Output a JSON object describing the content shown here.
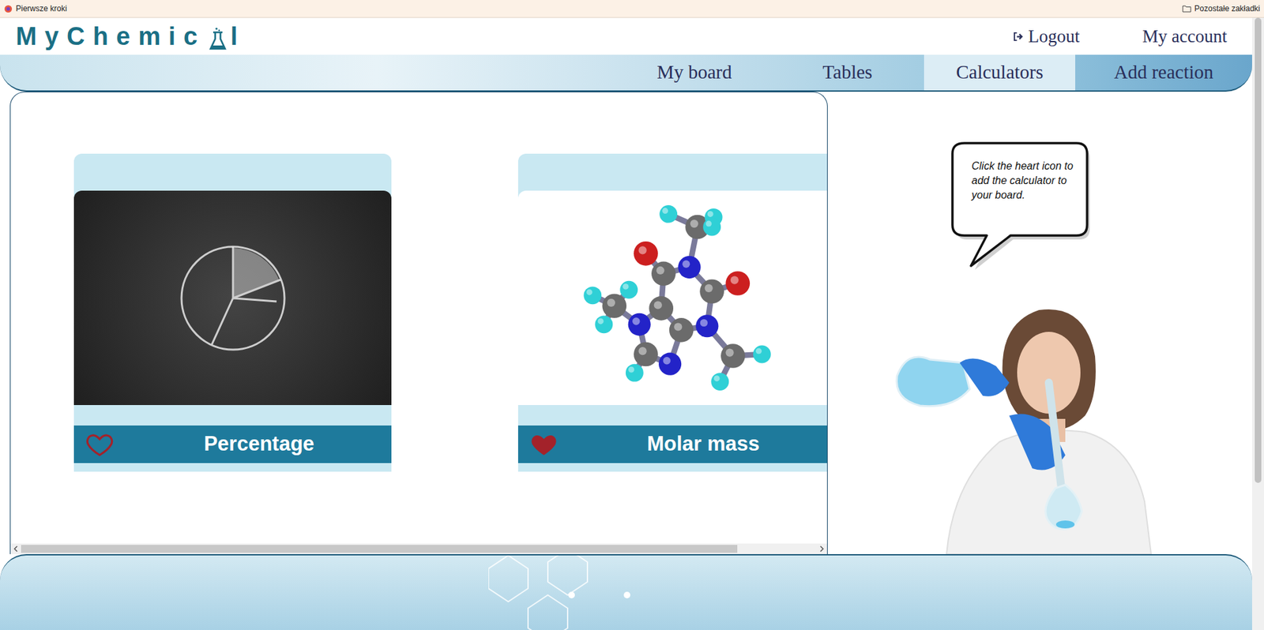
{
  "browser": {
    "bookmarks": [
      {
        "label": "Pierwsze kroki"
      }
    ],
    "other_bookmarks": "Pozostałe zakładki"
  },
  "logo": {
    "before": "MyChemic",
    "after": "l"
  },
  "header_links": [
    {
      "label": "Logout"
    },
    {
      "label": "My account"
    }
  ],
  "nav": [
    {
      "label": "My board",
      "selected": false
    },
    {
      "label": "Tables",
      "selected": false
    },
    {
      "label": "Calculators",
      "selected": true
    },
    {
      "label": "Add reaction",
      "selected": false
    }
  ],
  "calculators": [
    {
      "title": "Percentage",
      "favorite": false
    },
    {
      "title": "Molar mass",
      "favorite": true
    }
  ],
  "hint": "Click the heart icon to add the calculator to your board.",
  "scrollbars": {
    "horizontal": {
      "level": 0.9
    },
    "vertical": {
      "level": 0.76
    }
  }
}
